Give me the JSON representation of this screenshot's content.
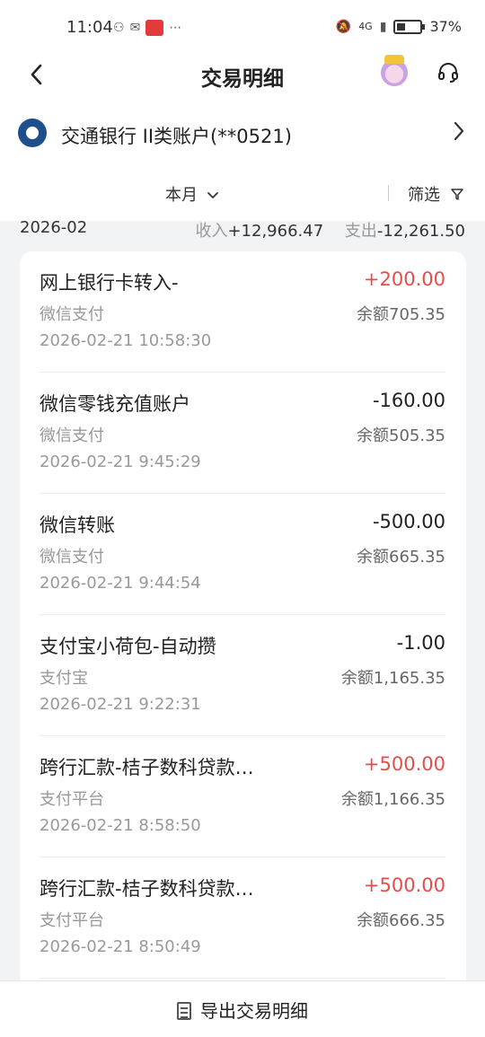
{
  "status_bar": {
    "time": "11:04",
    "network": "4G",
    "battery": "37%"
  },
  "nav": {
    "title": "交易明细"
  },
  "account": {
    "name": "交通银行 II类账户(**0521)"
  },
  "filter": {
    "month": "本月",
    "screen": "筛选"
  },
  "summary": {
    "month": "2026-02",
    "income_label": "收入",
    "income": "+12,966.47",
    "expense_label": "支出",
    "expense": "-12,261.50"
  },
  "transactions": [
    {
      "name": "网上银行卡转入-",
      "amount": "+200.00",
      "positive": true,
      "channel": "微信支付",
      "balance": "余额705.35",
      "datetime": "2026-02-21 10:58:30"
    },
    {
      "name": "微信零钱充值账户",
      "amount": "-160.00",
      "positive": false,
      "channel": "微信支付",
      "balance": "余额505.35",
      "datetime": "2026-02-21 9:45:29"
    },
    {
      "name": "微信转账",
      "amount": "-500.00",
      "positive": false,
      "channel": "微信支付",
      "balance": "余额665.35",
      "datetime": "2026-02-21 9:44:54"
    },
    {
      "name": "支付宝小荷包-自动攒",
      "amount": "-1.00",
      "positive": false,
      "channel": "支付宝",
      "balance": "余额1,165.35",
      "datetime": "2026-02-21 9:22:31"
    },
    {
      "name": "跨行汇款-桔子数科贷款…",
      "amount": "+500.00",
      "positive": true,
      "channel": "支付平台",
      "balance": "余额1,166.35",
      "datetime": "2026-02-21 8:58:50"
    },
    {
      "name": "跨行汇款-桔子数科贷款…",
      "amount": "+500.00",
      "positive": true,
      "channel": "支付平台",
      "balance": "余额666.35",
      "datetime": "2026-02-21 8:50:49"
    }
  ],
  "footer": {
    "export_label": "导出交易明细"
  },
  "colors": {
    "positive": "#e54d4d",
    "brand": "#1f4e8c"
  }
}
